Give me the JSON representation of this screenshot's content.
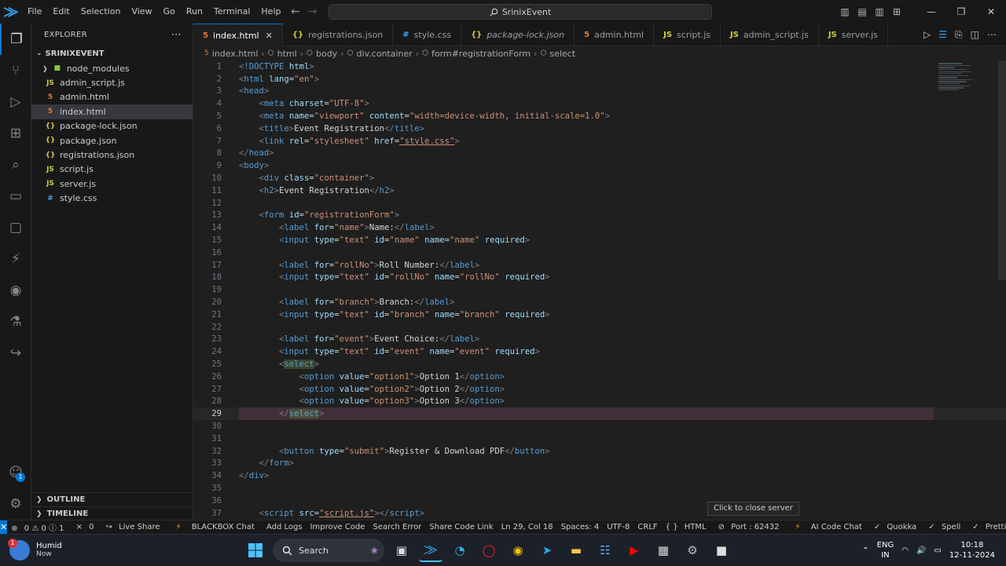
{
  "menu": [
    "File",
    "Edit",
    "Selection",
    "View",
    "Go",
    "Run",
    "Terminal",
    "Help"
  ],
  "command_center": "SrinixEvent",
  "explorer": {
    "title": "EXPLORER",
    "root": "SRINIXEVENT",
    "items": [
      {
        "name": "node_modules",
        "type": "folder"
      },
      {
        "name": "admin_script.js",
        "type": "js"
      },
      {
        "name": "admin.html",
        "type": "html"
      },
      {
        "name": "index.html",
        "type": "html",
        "selected": true
      },
      {
        "name": "package-lock.json",
        "type": "json"
      },
      {
        "name": "package.json",
        "type": "json"
      },
      {
        "name": "registrations.json",
        "type": "json"
      },
      {
        "name": "script.js",
        "type": "js"
      },
      {
        "name": "server.js",
        "type": "js"
      },
      {
        "name": "style.css",
        "type": "css"
      }
    ],
    "outline": "OUTLINE",
    "timeline": "TIMELINE"
  },
  "tabs": [
    {
      "label": "index.html",
      "type": "html",
      "active": true
    },
    {
      "label": "registrations.json",
      "type": "json"
    },
    {
      "label": "style.css",
      "type": "css"
    },
    {
      "label": "package-lock.json",
      "type": "json"
    },
    {
      "label": "admin.html",
      "type": "html"
    },
    {
      "label": "script.js",
      "type": "js"
    },
    {
      "label": "admin_script.js",
      "type": "js"
    },
    {
      "label": "server.js",
      "type": "js"
    }
  ],
  "breadcrumbs": [
    "index.html",
    "html",
    "body",
    "div.container",
    "form#registrationForm",
    "select"
  ],
  "tooltip": "Click to close server",
  "status": {
    "problems": "0 ⚠ 0 ⓘ 1",
    "ports": "0",
    "live_share": "Live Share",
    "blackbox": "BLACKBOX Chat",
    "add_logs": "Add Logs",
    "improve": "Improve Code",
    "search_error": "Search Error",
    "share": "Share Code Link",
    "position": "Ln 29, Col 18",
    "spaces": "Spaces: 4",
    "encoding": "UTF-8",
    "eol": "CRLF",
    "language": "HTML",
    "port": "Port : 62432",
    "ai": "AI Code Chat",
    "quokka": "Quokka",
    "spell": "Spell",
    "prettier": "Prettier"
  },
  "taskbar": {
    "weather_title": "Humid",
    "weather_sub": "Now",
    "search": "Search",
    "lang": "ENG",
    "region": "IN",
    "time": "10:18",
    "date": "12-11-2024"
  },
  "colors": {
    "accent": "#0078d4",
    "html_icon": "#e37933",
    "js_icon": "#cbcb41",
    "json_icon": "#cbcb41",
    "css_icon": "#42a5f5",
    "folder": "#8bc34a"
  }
}
